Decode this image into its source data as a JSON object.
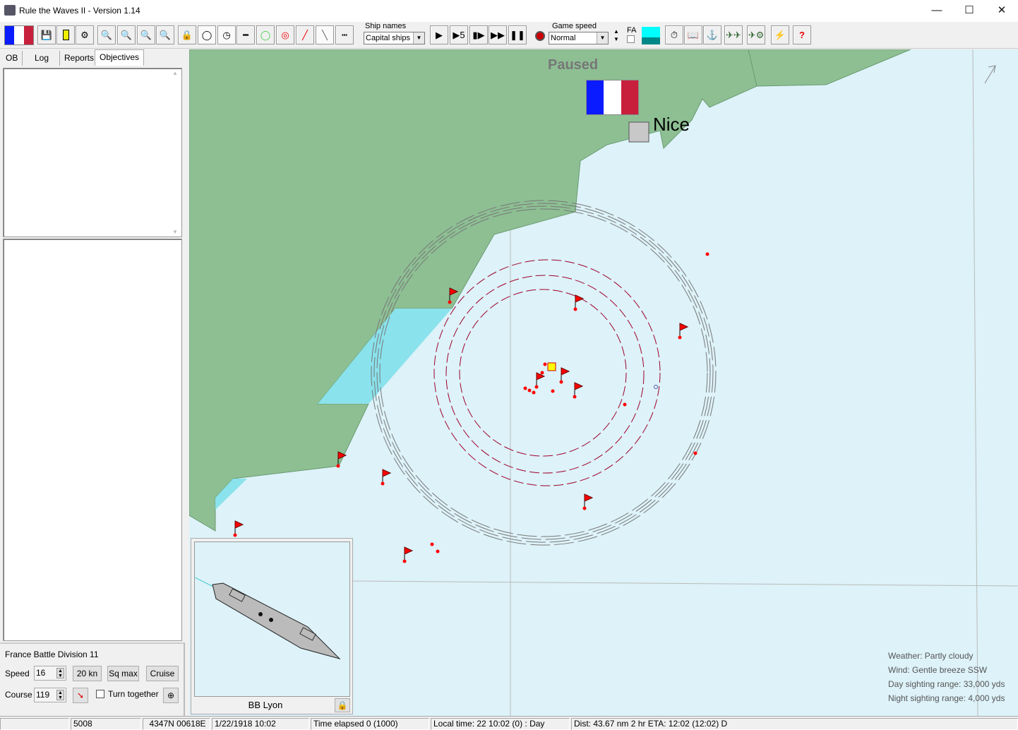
{
  "window": {
    "title": "Rule the Waves II - Version 1.14",
    "minimize": "—",
    "maximize": "☐",
    "close": "✕"
  },
  "toolbar": {
    "ship_names_label": "Ship names",
    "ship_names_value": "Capital ships",
    "game_speed_label": "Game speed",
    "game_speed_value": "Normal",
    "fa_label": "FA",
    "help": "?",
    "nation_flag_colors": [
      "#0a1cff",
      "#ffffff",
      "#c8203c"
    ]
  },
  "left": {
    "tabs": [
      {
        "label": "OB"
      },
      {
        "label": "Log"
      },
      {
        "label": "Reports"
      },
      {
        "label": "Objectives"
      }
    ],
    "active_tab": "Objectives",
    "division": "France Battle Division 11",
    "speed_label": "Speed",
    "speed_value": "16",
    "btn_20kn": "20 kn",
    "btn_sqmax": "Sq max",
    "btn_cruise": "Cruise",
    "course_label": "Course",
    "course_value": "119",
    "turn_together": "Turn together"
  },
  "map": {
    "paused": "Paused",
    "city": "Nice",
    "colors": {
      "sea": "#ddf2f9",
      "land": "#8dbf93",
      "shallow": "#8ae2ec",
      "flag": "#ff0000"
    },
    "ship_panel_name": "BB Lyon",
    "weather": "Weather: Partly cloudy",
    "wind": "Wind: Gentle breeze  SSW",
    "day_range": "Day sighting range: 33,000 yds",
    "night_range": "Night sighting range: 4,000 yds"
  },
  "status": {
    "c0": "",
    "c1": "5008",
    "c2": "4347N 00618E",
    "c3": "1/22/1918 10:02",
    "c4": "Time elapsed 0 (1000)",
    "c5": "Local time: 22 10:02 (0) : Day",
    "c6": "Dist: 43.67 nm 2 hr ETA: 12:02 (12:02) D"
  }
}
